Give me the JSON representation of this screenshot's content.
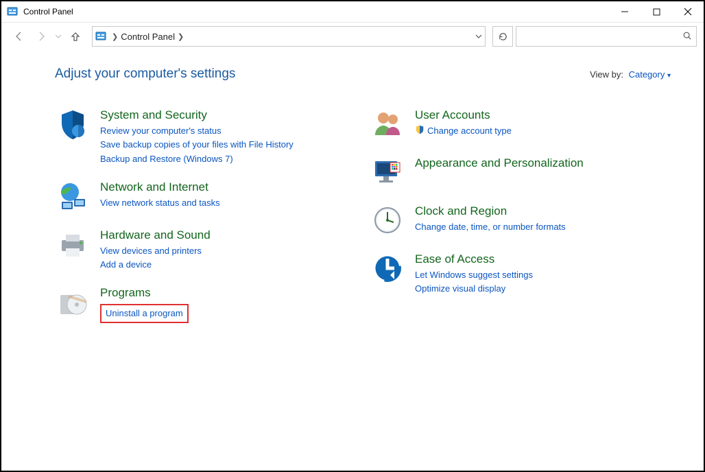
{
  "window": {
    "title": "Control Panel"
  },
  "breadcrumb": {
    "location": "Control Panel"
  },
  "header": {
    "title": "Adjust your computer's settings",
    "view_label": "View by:",
    "view_value": "Category"
  },
  "categories": {
    "system": {
      "title": "System and Security",
      "l1": "Review your computer's status",
      "l2": "Save backup copies of your files with File History",
      "l3": "Backup and Restore (Windows 7)"
    },
    "network": {
      "title": "Network and Internet",
      "l1": "View network status and tasks"
    },
    "hardware": {
      "title": "Hardware and Sound",
      "l1": "View devices and printers",
      "l2": "Add a device"
    },
    "programs": {
      "title": "Programs",
      "l1": "Uninstall a program"
    },
    "users": {
      "title": "User Accounts",
      "l1": "Change account type"
    },
    "appearance": {
      "title": "Appearance and Personalization"
    },
    "clock": {
      "title": "Clock and Region",
      "l1": "Change date, time, or number formats"
    },
    "ease": {
      "title": "Ease of Access",
      "l1": "Let Windows suggest settings",
      "l2": "Optimize visual display"
    }
  }
}
